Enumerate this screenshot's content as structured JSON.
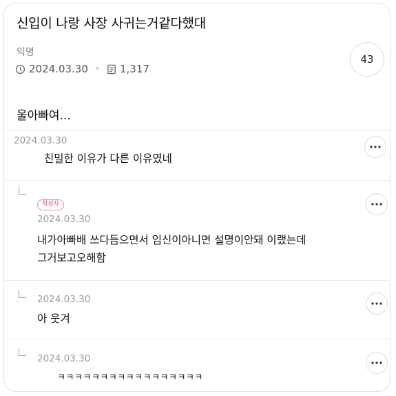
{
  "post": {
    "title": "신입이 나랑 사장 사귀는거같다했대",
    "author": "익명",
    "date": "2024.03.30",
    "views": "1,317",
    "comment_count": "43",
    "body": "울아빠여..."
  },
  "comments": [
    {
      "date": "2024.03.30",
      "text": "친밀한 이유가 다른 이유였네"
    },
    {
      "badge": "작성자",
      "date": "2024.03.30",
      "line1": "내가아빠배       쓰다듬으면서 임신이아니면 설명이안돼 이랬는데",
      "line2": "그거보고오해함"
    },
    {
      "date": "2024.03.30",
      "text": "아    웃겨"
    },
    {
      "date": "2024.03.30",
      "text": "ㅋㅋㅋㅋㅋㅋㅋㅋㅋㅋㅋㅋㅋㅋㅋㅋㅋ"
    }
  ],
  "icons": {
    "clock": "clock-icon",
    "views": "document-icon",
    "more": "more-dots-icon",
    "reply": "reply-arrow-icon"
  }
}
